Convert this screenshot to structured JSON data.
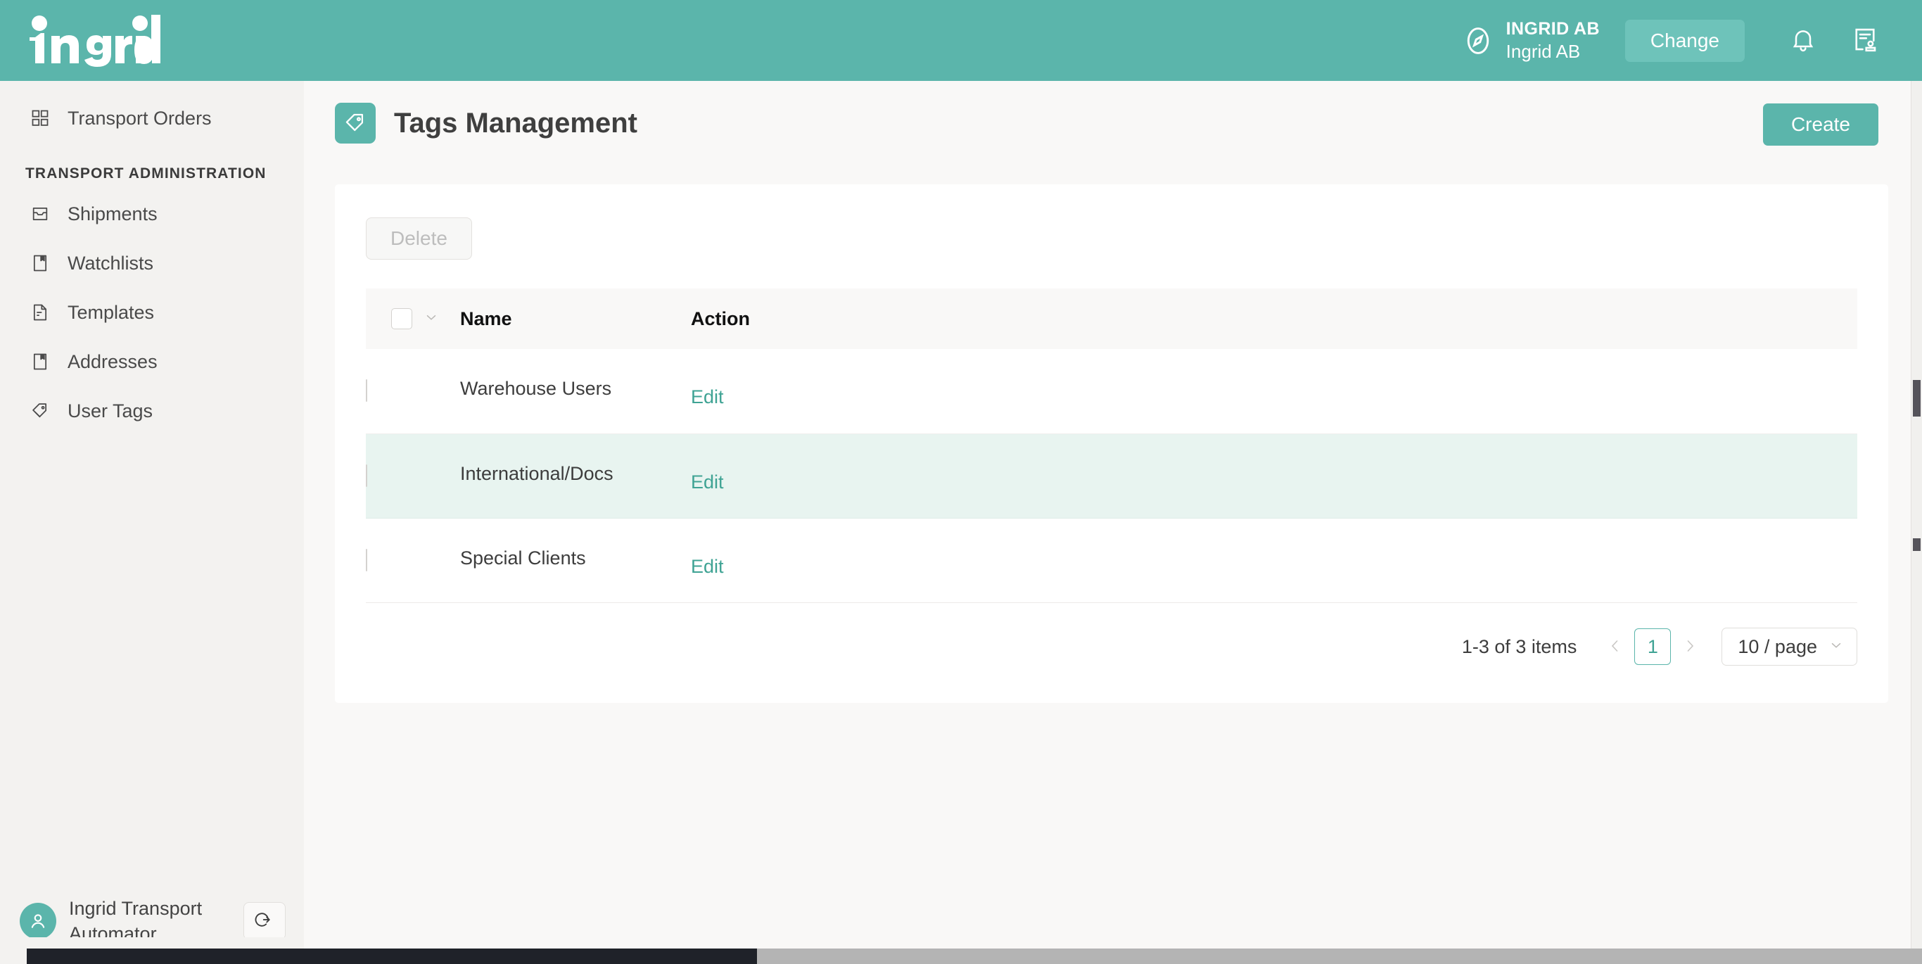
{
  "header": {
    "brand": "ingrid",
    "org_icon": "compass-icon",
    "org_name": "INGRID AB",
    "org_sub": "Ingrid AB",
    "change_label": "Change",
    "bell_icon": "bell-icon",
    "contract_icon": "document-user-icon",
    "bg_color": "#5bb5ab",
    "change_btn_color": "#6ec3ba"
  },
  "sidebar": {
    "top_item": {
      "label": "Transport Orders",
      "icon": "grid-icon"
    },
    "section_title": "TRANSPORT ADMINISTRATION",
    "items": [
      {
        "label": "Shipments",
        "icon": "inbox-icon"
      },
      {
        "label": "Watchlists",
        "icon": "bookmark-document-icon"
      },
      {
        "label": "Templates",
        "icon": "file-text-icon"
      },
      {
        "label": "Addresses",
        "icon": "bookmark-document-icon"
      },
      {
        "label": "User Tags",
        "icon": "tag-icon"
      }
    ],
    "user": {
      "avatar_icon": "person-icon",
      "name": "Ingrid Transport Automator",
      "logout_icon": "logout-icon",
      "avatar_color": "#5bb5ab"
    }
  },
  "main": {
    "page_icon": "tag-icon",
    "page_title": "Tags Management",
    "create_label": "Create",
    "delete_label": "Delete",
    "delete_disabled": true,
    "table": {
      "header_checkbox_icon": "checkbox-icon",
      "header_dropdown_icon": "chevron-down-icon",
      "columns": [
        "Name",
        "Action"
      ],
      "rows": [
        {
          "name": "Warehouse Users",
          "action": "Edit",
          "highlighted": false
        },
        {
          "name": "International/Docs",
          "action": "Edit",
          "highlighted": true
        },
        {
          "name": "Special Clients",
          "action": "Edit",
          "highlighted": false
        }
      ]
    },
    "pagination": {
      "total_text": "1-3 of 3 items",
      "prev_icon": "chevron-left-icon",
      "next_icon": "chevron-right-icon",
      "current_page": "1",
      "page_size": "10 / page",
      "page_size_icon": "chevron-down-icon",
      "accent_color": "#5bb5ab"
    }
  }
}
